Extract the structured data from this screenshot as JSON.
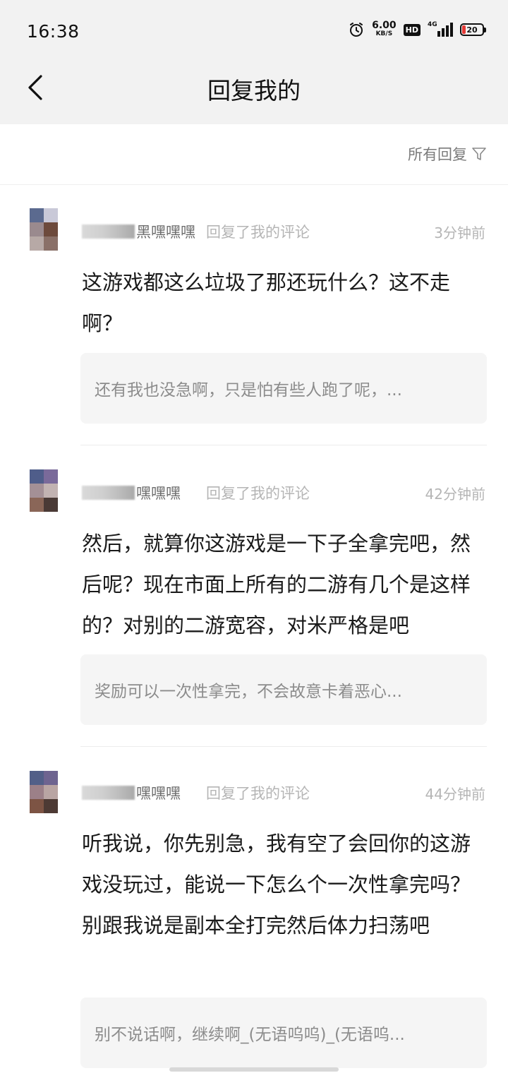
{
  "status_bar": {
    "time": "16:38",
    "net_speed": "6.00",
    "net_speed_unit": "KB/S",
    "hd_label": "HD",
    "signal_label": "4G",
    "battery": "20",
    "icons": [
      "alarm-icon",
      "hd-icon",
      "signal-icon",
      "battery-icon"
    ]
  },
  "header": {
    "title": "回复我的",
    "back_icon": "chevron-left-icon"
  },
  "filter": {
    "label": "所有回复",
    "icon": "funnel-icon"
  },
  "comments": [
    {
      "username": "黑嘿嘿嘿",
      "action": "回复了我的评论",
      "time": "3分钟前",
      "body": "这游戏都这么垃圾了那还玩什么？这不走啊？",
      "quote": "还有我也没急啊，只是怕有些人跑了呢，..."
    },
    {
      "username": "嘿嘿嘿",
      "action": "回复了我的评论",
      "time": "42分钟前",
      "body": "然后，就算你这游戏是一下子全拿完吧，然后呢？现在市面上所有的二游有几个是这样的？对别的二游宽容，对米严格是吧",
      "quote": "奖励可以一次性拿完，不会故意卡着恶心..."
    },
    {
      "username": "嘿嘿嘿",
      "action": "回复了我的评论",
      "time": "44分钟前",
      "body": "听我说，你先别急，我有空了会回你的这游戏没玩过，能说一下怎么个一次性拿完吗？别跟我说是副本全打完然后体力扫荡吧",
      "quote": "别不说话啊，继续啊_(无语呜呜)_(无语呜..."
    }
  ]
}
